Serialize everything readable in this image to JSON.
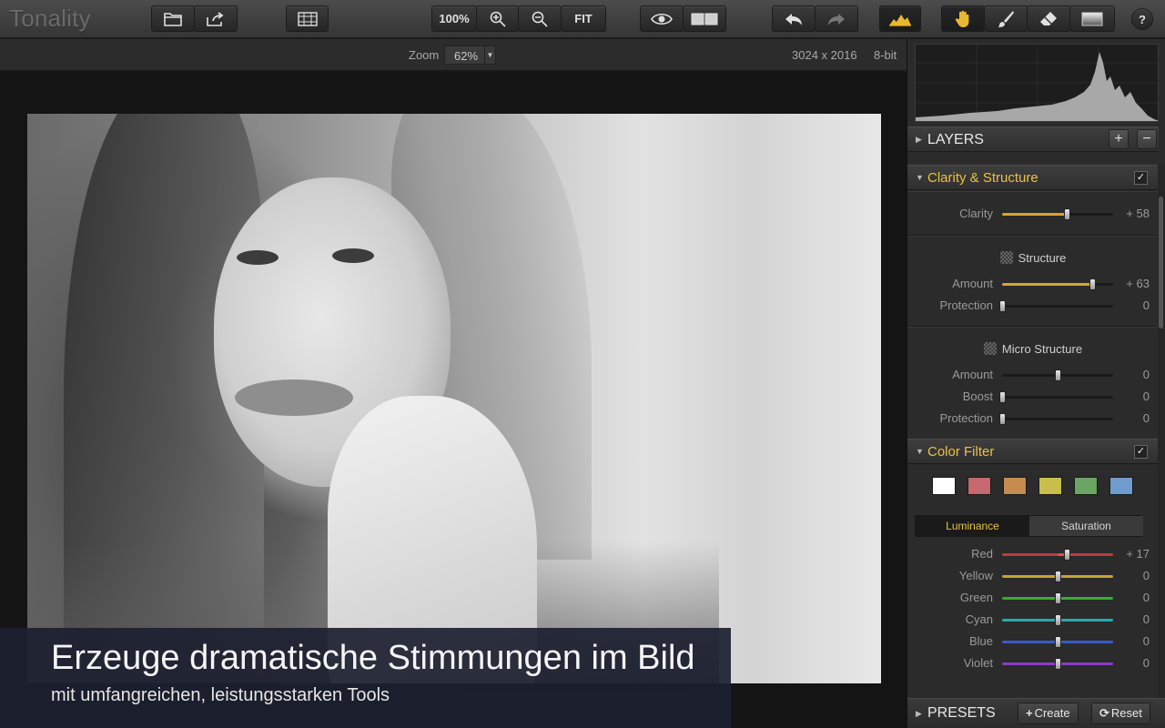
{
  "app": {
    "title": "Tonality"
  },
  "toolbar": {
    "zoom_100": "100%",
    "fit": "FIT",
    "help": "?",
    "icons": [
      "open-folder-icon",
      "share-icon",
      "grid-icon",
      "zoom-in-icon",
      "zoom-out-icon",
      "eye-icon",
      "compare-icon",
      "undo-icon",
      "redo-icon",
      "histogram-icon",
      "hand-icon",
      "brush-icon",
      "eraser-icon",
      "gradient-icon"
    ]
  },
  "zoombar": {
    "label": "Zoom",
    "value": "62%",
    "dimensions": "3024 x 2016",
    "bit_depth": "8-bit"
  },
  "caption": {
    "headline": "Erzeuge dramatische Stimmungen im Bild",
    "subline": "mit umfangreichen, leistungsstarken Tools"
  },
  "panel": {
    "layers": {
      "title": "LAYERS",
      "add": "+",
      "remove": "−"
    },
    "clarity": {
      "title": "Clarity & Structure",
      "checked": "✓",
      "clarity": {
        "label": "Clarity",
        "value": "+ 58",
        "pct": 0.58
      },
      "structure_head": "Structure",
      "structure_amount": {
        "label": "Amount",
        "value": "+ 63",
        "pct": 0.815
      },
      "structure_protection": {
        "label": "Protection",
        "value": "0",
        "pct": 0
      },
      "micro_head": "Micro Structure",
      "micro_amount": {
        "label": "Amount",
        "value": "0",
        "pct": 0.5
      },
      "micro_boost": {
        "label": "Boost",
        "value": "0",
        "pct": 0
      },
      "micro_protection": {
        "label": "Protection",
        "value": "0",
        "pct": 0
      }
    },
    "color_filter": {
      "title": "Color Filter",
      "checked": "✓",
      "swatches": [
        "#ffffff",
        "#c7676e",
        "#c58c4e",
        "#c9bd4b",
        "#6aa662",
        "#6f9ccc"
      ],
      "tab_luminance": "Luminance",
      "tab_saturation": "Saturation",
      "red": {
        "label": "Red",
        "value": "+ 17",
        "pct": 0.585,
        "color": "#c23a3a"
      },
      "yellow": {
        "label": "Yellow",
        "value": "0",
        "pct": 0.5,
        "color": "#bfa62e"
      },
      "green": {
        "label": "Green",
        "value": "0",
        "pct": 0.5,
        "color": "#3aa83a"
      },
      "cyan": {
        "label": "Cyan",
        "value": "0",
        "pct": 0.5,
        "color": "#2aa8a8"
      },
      "blue": {
        "label": "Blue",
        "value": "0",
        "pct": 0.5,
        "color": "#3a5ac8"
      },
      "violet": {
        "label": "Violet",
        "value": "0",
        "pct": 0.5,
        "color": "#8a3ac8"
      }
    },
    "presets": {
      "title": "PRESETS",
      "create": "Create",
      "reset": "Reset"
    }
  }
}
